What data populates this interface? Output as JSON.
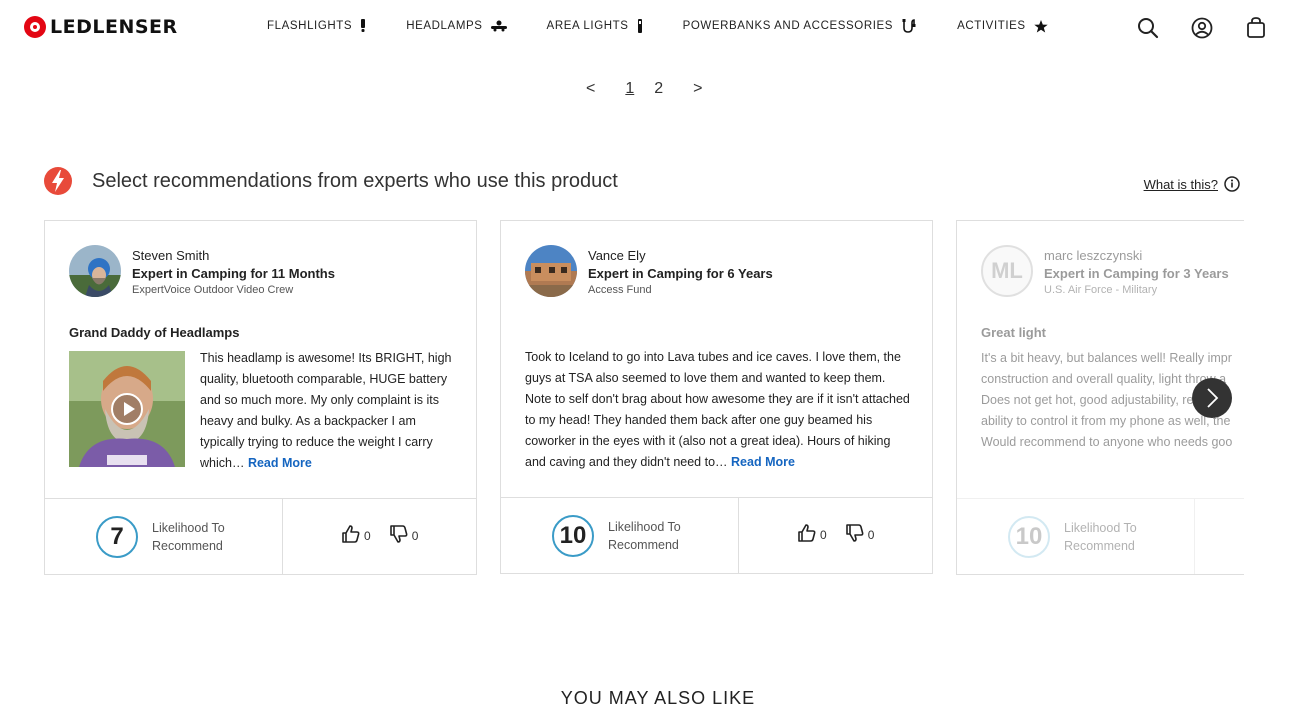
{
  "header": {
    "brand": "LEDLENSER",
    "nav": [
      {
        "label": "FLASHLIGHTS",
        "icon": "flashlight-icon"
      },
      {
        "label": "HEADLAMPS",
        "icon": "headlamp-icon"
      },
      {
        "label": "AREA LIGHTS",
        "icon": "area-light-icon"
      },
      {
        "label": "POWERBANKS AND ACCESSORIES",
        "icon": "cable-icon"
      },
      {
        "label": "ACTIVITIES",
        "icon": "star-icon"
      }
    ],
    "icons": [
      "search-icon",
      "account-icon",
      "cart-icon"
    ]
  },
  "pagination": {
    "prev": "<",
    "pages": [
      "1",
      "2"
    ],
    "current": "1",
    "next": ">"
  },
  "experts": {
    "title": "Select recommendations from experts who use this product",
    "what_link": "What is this?",
    "cards": [
      {
        "name": "Steven Smith",
        "title": "Expert in Camping for 11 Months",
        "org": "ExpertVoice Outdoor Video Crew",
        "heading": "Grand Daddy of Headlamps",
        "text": "This headlamp is awesome! Its BRIGHT, high quality, bluetooth comparable, HUGE battery and so much more. My only complaint is its heavy and bulky. As a backpacker I am typically trying to reduce the weight I carry which…",
        "read_more": "Read More",
        "score": "7",
        "score_label": "Likelihood To Recommend",
        "up": "0",
        "down": "0"
      },
      {
        "name": "Vance Ely",
        "title": "Expert in Camping for 6 Years",
        "org": "Access Fund",
        "heading": "",
        "text": "Took to Iceland to go into Lava tubes and ice caves. I love them, the guys at TSA also seemed to love them and wanted to keep them. Note to self don't brag about how awesome they are if it isn't attached to my head! They handed them back after one guy beamed his coworker in the eyes with it (also not a great idea). Hours of hiking and caving and they didn't need to…",
        "read_more": "Read More",
        "score": "10",
        "score_label": "Likelihood To Recommend",
        "up": "0",
        "down": "0"
      },
      {
        "name": "marc leszczynski",
        "initials": "ML",
        "title": "Expert in Camping for 3 Years",
        "org": "U.S. Air Force - Military",
        "heading": "Great light",
        "lines": [
          "It's a bit heavy, but balances well! Really impr",
          "construction and overall quality, light throw a",
          "Does not get hot, good adjustability, really im",
          "ability to control it from my phone as well, the",
          "Would recommend to anyone who needs goo"
        ],
        "score": "10",
        "score_label": "Likelihood To Recommend"
      }
    ]
  },
  "also_like": "YOU MAY ALSO LIKE",
  "colors": {
    "brand_red": "#e30613",
    "link_blue": "#1565c0",
    "score_ring": "#3a9bc7"
  }
}
